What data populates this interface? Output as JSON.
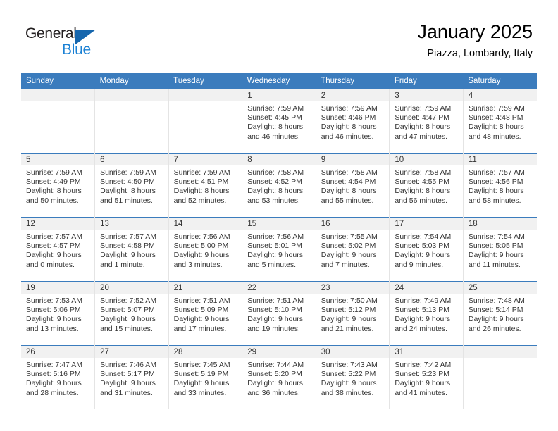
{
  "brand": {
    "name_part1": "General",
    "name_part2": "Blue"
  },
  "header": {
    "month_title": "January 2025",
    "location": "Piazza, Lombardy, Italy"
  },
  "colors": {
    "header_blue": "#3b7cbd",
    "logo_blue": "#1b81d4",
    "daynum_band": "#f1f1f1"
  },
  "weekday_headers": [
    "Sunday",
    "Monday",
    "Tuesday",
    "Wednesday",
    "Thursday",
    "Friday",
    "Saturday"
  ],
  "weeks": [
    [
      {
        "day": "",
        "sunrise": "",
        "sunset": "",
        "daylight1": "",
        "daylight2": "",
        "empty": true
      },
      {
        "day": "",
        "sunrise": "",
        "sunset": "",
        "daylight1": "",
        "daylight2": "",
        "empty": true
      },
      {
        "day": "",
        "sunrise": "",
        "sunset": "",
        "daylight1": "",
        "daylight2": "",
        "empty": true
      },
      {
        "day": "1",
        "sunrise": "Sunrise: 7:59 AM",
        "sunset": "Sunset: 4:45 PM",
        "daylight1": "Daylight: 8 hours",
        "daylight2": "and 46 minutes."
      },
      {
        "day": "2",
        "sunrise": "Sunrise: 7:59 AM",
        "sunset": "Sunset: 4:46 PM",
        "daylight1": "Daylight: 8 hours",
        "daylight2": "and 46 minutes."
      },
      {
        "day": "3",
        "sunrise": "Sunrise: 7:59 AM",
        "sunset": "Sunset: 4:47 PM",
        "daylight1": "Daylight: 8 hours",
        "daylight2": "and 47 minutes."
      },
      {
        "day": "4",
        "sunrise": "Sunrise: 7:59 AM",
        "sunset": "Sunset: 4:48 PM",
        "daylight1": "Daylight: 8 hours",
        "daylight2": "and 48 minutes."
      }
    ],
    [
      {
        "day": "5",
        "sunrise": "Sunrise: 7:59 AM",
        "sunset": "Sunset: 4:49 PM",
        "daylight1": "Daylight: 8 hours",
        "daylight2": "and 50 minutes."
      },
      {
        "day": "6",
        "sunrise": "Sunrise: 7:59 AM",
        "sunset": "Sunset: 4:50 PM",
        "daylight1": "Daylight: 8 hours",
        "daylight2": "and 51 minutes."
      },
      {
        "day": "7",
        "sunrise": "Sunrise: 7:59 AM",
        "sunset": "Sunset: 4:51 PM",
        "daylight1": "Daylight: 8 hours",
        "daylight2": "and 52 minutes."
      },
      {
        "day": "8",
        "sunrise": "Sunrise: 7:58 AM",
        "sunset": "Sunset: 4:52 PM",
        "daylight1": "Daylight: 8 hours",
        "daylight2": "and 53 minutes."
      },
      {
        "day": "9",
        "sunrise": "Sunrise: 7:58 AM",
        "sunset": "Sunset: 4:54 PM",
        "daylight1": "Daylight: 8 hours",
        "daylight2": "and 55 minutes."
      },
      {
        "day": "10",
        "sunrise": "Sunrise: 7:58 AM",
        "sunset": "Sunset: 4:55 PM",
        "daylight1": "Daylight: 8 hours",
        "daylight2": "and 56 minutes."
      },
      {
        "day": "11",
        "sunrise": "Sunrise: 7:57 AM",
        "sunset": "Sunset: 4:56 PM",
        "daylight1": "Daylight: 8 hours",
        "daylight2": "and 58 minutes."
      }
    ],
    [
      {
        "day": "12",
        "sunrise": "Sunrise: 7:57 AM",
        "sunset": "Sunset: 4:57 PM",
        "daylight1": "Daylight: 9 hours",
        "daylight2": "and 0 minutes."
      },
      {
        "day": "13",
        "sunrise": "Sunrise: 7:57 AM",
        "sunset": "Sunset: 4:58 PM",
        "daylight1": "Daylight: 9 hours",
        "daylight2": "and 1 minute."
      },
      {
        "day": "14",
        "sunrise": "Sunrise: 7:56 AM",
        "sunset": "Sunset: 5:00 PM",
        "daylight1": "Daylight: 9 hours",
        "daylight2": "and 3 minutes."
      },
      {
        "day": "15",
        "sunrise": "Sunrise: 7:56 AM",
        "sunset": "Sunset: 5:01 PM",
        "daylight1": "Daylight: 9 hours",
        "daylight2": "and 5 minutes."
      },
      {
        "day": "16",
        "sunrise": "Sunrise: 7:55 AM",
        "sunset": "Sunset: 5:02 PM",
        "daylight1": "Daylight: 9 hours",
        "daylight2": "and 7 minutes."
      },
      {
        "day": "17",
        "sunrise": "Sunrise: 7:54 AM",
        "sunset": "Sunset: 5:03 PM",
        "daylight1": "Daylight: 9 hours",
        "daylight2": "and 9 minutes."
      },
      {
        "day": "18",
        "sunrise": "Sunrise: 7:54 AM",
        "sunset": "Sunset: 5:05 PM",
        "daylight1": "Daylight: 9 hours",
        "daylight2": "and 11 minutes."
      }
    ],
    [
      {
        "day": "19",
        "sunrise": "Sunrise: 7:53 AM",
        "sunset": "Sunset: 5:06 PM",
        "daylight1": "Daylight: 9 hours",
        "daylight2": "and 13 minutes."
      },
      {
        "day": "20",
        "sunrise": "Sunrise: 7:52 AM",
        "sunset": "Sunset: 5:07 PM",
        "daylight1": "Daylight: 9 hours",
        "daylight2": "and 15 minutes."
      },
      {
        "day": "21",
        "sunrise": "Sunrise: 7:51 AM",
        "sunset": "Sunset: 5:09 PM",
        "daylight1": "Daylight: 9 hours",
        "daylight2": "and 17 minutes."
      },
      {
        "day": "22",
        "sunrise": "Sunrise: 7:51 AM",
        "sunset": "Sunset: 5:10 PM",
        "daylight1": "Daylight: 9 hours",
        "daylight2": "and 19 minutes."
      },
      {
        "day": "23",
        "sunrise": "Sunrise: 7:50 AM",
        "sunset": "Sunset: 5:12 PM",
        "daylight1": "Daylight: 9 hours",
        "daylight2": "and 21 minutes."
      },
      {
        "day": "24",
        "sunrise": "Sunrise: 7:49 AM",
        "sunset": "Sunset: 5:13 PM",
        "daylight1": "Daylight: 9 hours",
        "daylight2": "and 24 minutes."
      },
      {
        "day": "25",
        "sunrise": "Sunrise: 7:48 AM",
        "sunset": "Sunset: 5:14 PM",
        "daylight1": "Daylight: 9 hours",
        "daylight2": "and 26 minutes."
      }
    ],
    [
      {
        "day": "26",
        "sunrise": "Sunrise: 7:47 AM",
        "sunset": "Sunset: 5:16 PM",
        "daylight1": "Daylight: 9 hours",
        "daylight2": "and 28 minutes."
      },
      {
        "day": "27",
        "sunrise": "Sunrise: 7:46 AM",
        "sunset": "Sunset: 5:17 PM",
        "daylight1": "Daylight: 9 hours",
        "daylight2": "and 31 minutes."
      },
      {
        "day": "28",
        "sunrise": "Sunrise: 7:45 AM",
        "sunset": "Sunset: 5:19 PM",
        "daylight1": "Daylight: 9 hours",
        "daylight2": "and 33 minutes."
      },
      {
        "day": "29",
        "sunrise": "Sunrise: 7:44 AM",
        "sunset": "Sunset: 5:20 PM",
        "daylight1": "Daylight: 9 hours",
        "daylight2": "and 36 minutes."
      },
      {
        "day": "30",
        "sunrise": "Sunrise: 7:43 AM",
        "sunset": "Sunset: 5:22 PM",
        "daylight1": "Daylight: 9 hours",
        "daylight2": "and 38 minutes."
      },
      {
        "day": "31",
        "sunrise": "Sunrise: 7:42 AM",
        "sunset": "Sunset: 5:23 PM",
        "daylight1": "Daylight: 9 hours",
        "daylight2": "and 41 minutes."
      },
      {
        "day": "",
        "sunrise": "",
        "sunset": "",
        "daylight1": "",
        "daylight2": "",
        "empty": true
      }
    ]
  ]
}
